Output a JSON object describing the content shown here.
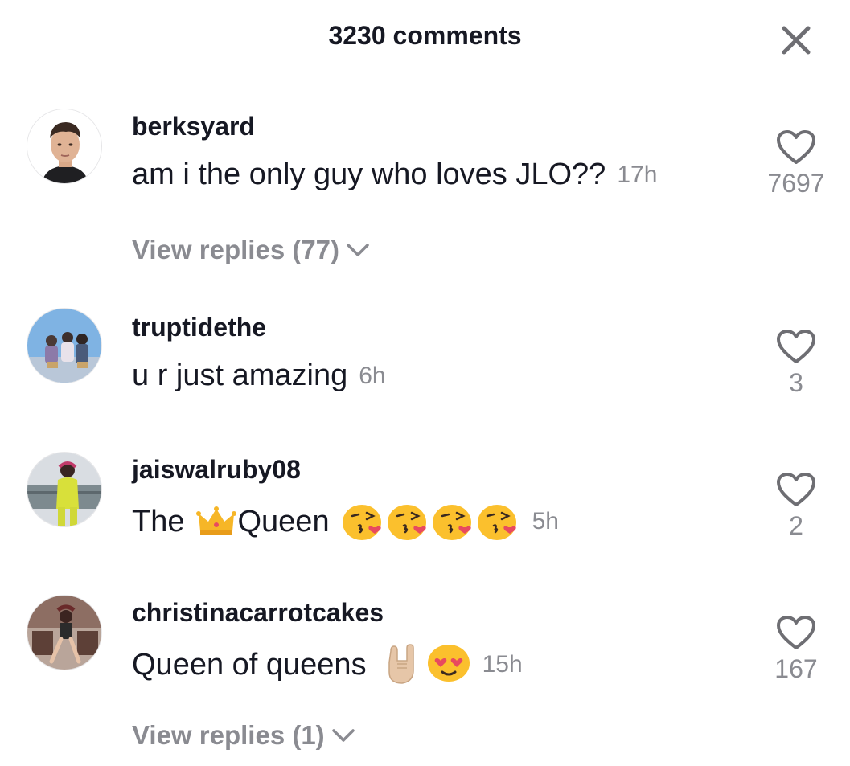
{
  "header": {
    "title": "3230 comments",
    "close_icon": "close-icon"
  },
  "colors": {
    "text": "#161823",
    "secondary": "#8a8b91",
    "background": "#ffffff"
  },
  "comments": [
    {
      "username": "berksyard",
      "text": "am i the only guy who loves JLO??",
      "time": "17h",
      "likes": "7697",
      "replies_label": "View replies (77)"
    },
    {
      "username": "truptidethe",
      "text": "u r just amazing",
      "time": "6h",
      "likes": "3"
    },
    {
      "username": "jaiswalruby08",
      "text_before": "The",
      "text_after": "Queen",
      "emojis": [
        "crown-emoji",
        "kiss-emoji",
        "kiss-emoji",
        "kiss-emoji",
        "kiss-emoji"
      ],
      "time": "5h",
      "likes": "2"
    },
    {
      "username": "christinacarrotcakes",
      "text": "Queen of queens",
      "emojis": [
        "rock-hand-emoji",
        "heart-eyes-emoji"
      ],
      "time": "15h",
      "likes": "167",
      "replies_label": "View replies (1)"
    }
  ]
}
